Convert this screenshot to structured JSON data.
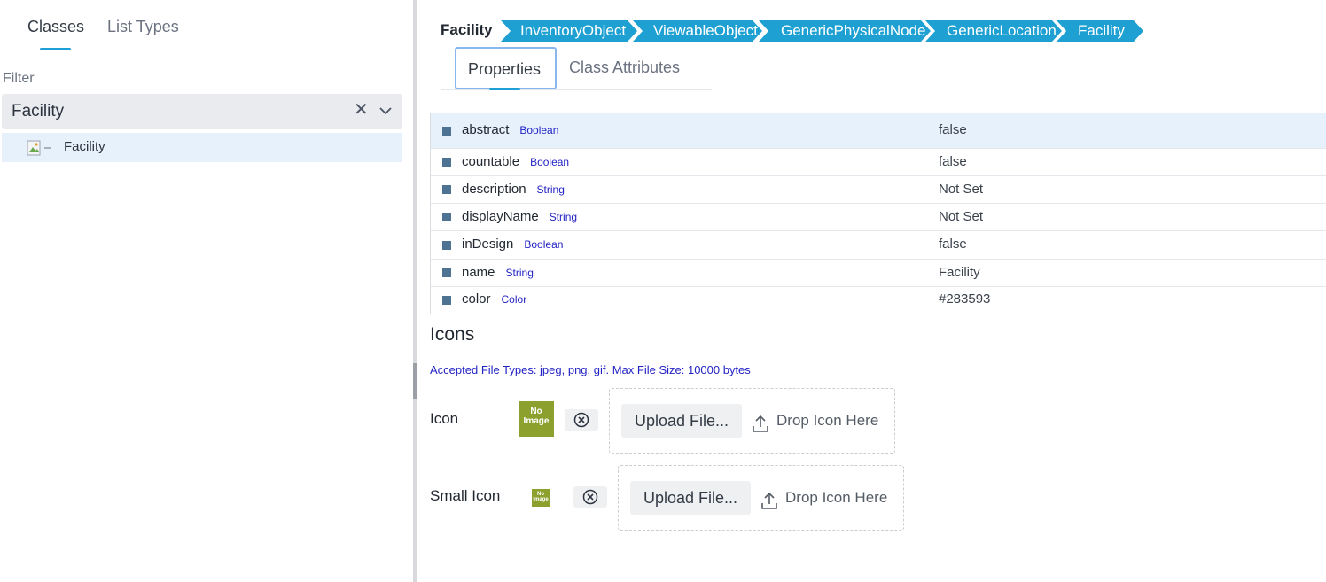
{
  "left_panel": {
    "tabs": [
      "Classes",
      "List Types"
    ],
    "filter_label": "Filter",
    "filter_value": "Facility",
    "tree_item_label": "Facility"
  },
  "header": {
    "title": "Facility",
    "breadcrumbs": [
      "InventoryObject",
      "ViewableObject",
      "GenericPhysicalNode",
      "GenericLocation",
      "Facility"
    ],
    "tabs": [
      "Properties",
      "Class Attributes"
    ]
  },
  "properties": [
    {
      "name": "abstract",
      "type": "Boolean",
      "value": "false"
    },
    {
      "name": "countable",
      "type": "Boolean",
      "value": "false"
    },
    {
      "name": "description",
      "type": "String",
      "value": "Not Set"
    },
    {
      "name": "displayName",
      "type": "String",
      "value": "Not Set"
    },
    {
      "name": "inDesign",
      "type": "Boolean",
      "value": "false"
    },
    {
      "name": "name",
      "type": "String",
      "value": "Facility"
    },
    {
      "name": "color",
      "type": "Color",
      "value": "#283593"
    }
  ],
  "icons_section": {
    "title": "Icons",
    "accepted_note": "Accepted File Types: jpeg, png, gif. Max File Size: 10000 bytes",
    "icon_label": "Icon",
    "small_icon_label": "Small Icon",
    "no_image_line1": "No",
    "no_image_line2": "Image",
    "upload_label": "Upload File...",
    "drop_label": "Drop Icon Here"
  },
  "colors": {
    "accent": "#1e9fd6",
    "breadcrumb": "#1ea0d2",
    "selected_row": "#e6f1fc",
    "type_text": "#2323c4",
    "no_image_bg": "#8ca02e"
  }
}
